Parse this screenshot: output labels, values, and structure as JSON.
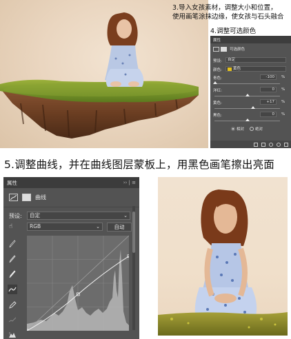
{
  "captions": {
    "step3_line1": "3.导入女孩素材，调整大小和位置，",
    "step3_line2": "使用画笔涂抹边缘，使女孩与石头融合",
    "step4": "4.调整可选颜色",
    "step5": "5.调整曲线，并在曲线图层蒙板上，用黑色画笔擦出亮面"
  },
  "selective_color_panel": {
    "tab_label": "属性",
    "layer_label": "可选颜色",
    "preset_label": "预设:",
    "preset_value": "自定",
    "colors_label": "颜色:",
    "colors_value": "黄色",
    "swatch_color": "#e6c21a",
    "sliders": [
      {
        "label": "青色:",
        "value": "-100",
        "unit": "%",
        "level": -100
      },
      {
        "label": "洋红:",
        "value": "0",
        "unit": "%",
        "level": 0
      },
      {
        "label": "黄色:",
        "value": "+17",
        "unit": "%",
        "level": 17
      },
      {
        "label": "黑色:",
        "value": "0",
        "unit": "%",
        "level": 0
      }
    ],
    "method_relative": "相对",
    "method_absolute": "绝对",
    "method_selected": "相对"
  },
  "curves_panel": {
    "tab_label": "属性",
    "panel_controls": "›› | ≡",
    "layer_label": "曲线",
    "preset_label": "预设:",
    "preset_value": "自定",
    "channel_value": "RGB",
    "auto_button": "自动",
    "tools": [
      "hand-adjust-icon",
      "black-point-eyedropper-icon",
      "gray-point-eyedropper-icon",
      "white-point-eyedropper-icon",
      "curve-point-icon",
      "pencil-icon",
      "smooth-icon",
      "clipping-warning-icon"
    ],
    "curve_points": [
      {
        "input": 0,
        "output": 0
      },
      {
        "input": 128,
        "output": 98
      },
      {
        "input": 255,
        "output": 200
      }
    ]
  },
  "colors": {
    "panel_bg": "#535353",
    "panel_header": "#3c3c3c",
    "field_bg": "#454545",
    "text_light": "#e6e6e6"
  }
}
